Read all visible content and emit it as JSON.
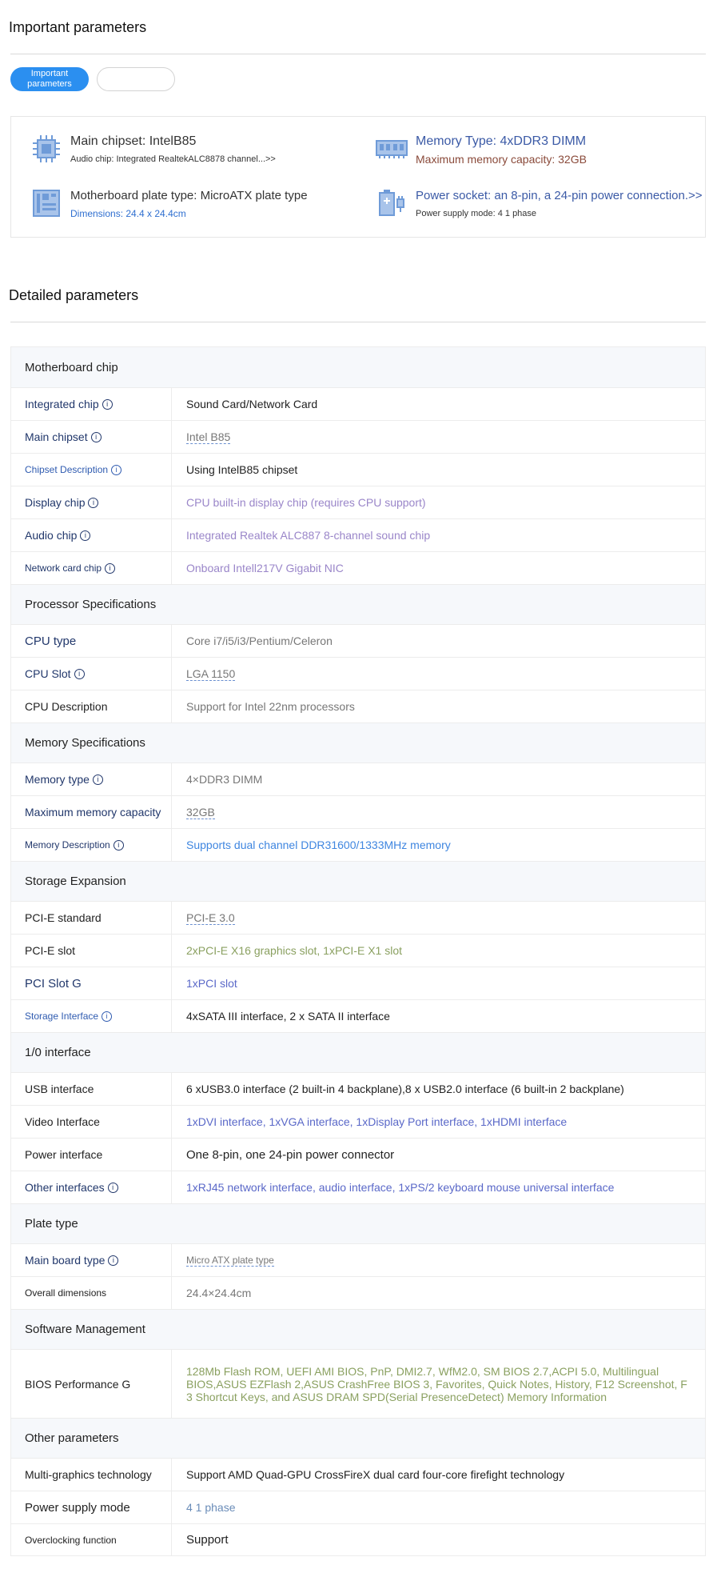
{
  "important": {
    "title": "Important parameters",
    "tabs": [
      "Important\nparameters",
      ""
    ],
    "items": [
      {
        "main": "Main chipset: IntelB85",
        "sub": "Audio chip: Integrated RealtekALC8878 channel...>>",
        "icon": "chip-icon"
      },
      {
        "main": "Memory Type: 4xDDR3 DIMM",
        "sub": "Maximum memory capacity: 32GB",
        "icon": "memory-icon"
      },
      {
        "main": "Motherboard plate type: MicroATX plate type",
        "sub": "Dimensions: 24.4 x 24.4cm",
        "icon": "board-icon"
      },
      {
        "main": "Power socket: an 8-pin, a 24-pin power connection.>>",
        "sub": "Power supply mode: 4 1 phase",
        "icon": "power-icon"
      }
    ]
  },
  "detailed": {
    "title": "Detailed parameters",
    "rows": [
      {
        "type": "group",
        "label": "Motherboard chip",
        "h": 50
      },
      {
        "type": "row",
        "label": "Integrated chip",
        "info": true,
        "value": "Sound Card/Network Card",
        "lc": "lbl-navy",
        "vc": "lbl-dark",
        "h": 41
      },
      {
        "type": "row",
        "label": "Main chipset",
        "info": true,
        "value": "Intel B85",
        "dotted": true,
        "lc": "lbl-navy",
        "vc": "val-gray",
        "h": 41
      },
      {
        "type": "row",
        "label": "Chipset Description",
        "info": true,
        "value": "Using IntelB85 chipset",
        "lc": "lbl-blue",
        "vc": "lbl-dark",
        "h": 41,
        "ls": 12
      },
      {
        "type": "row",
        "label": "Display chip",
        "info": true,
        "value": "CPU built-in display chip (requires CPU support)",
        "lc": "lbl-navy",
        "vc": "val-purple",
        "h": 41
      },
      {
        "type": "row",
        "label": "Audio chip",
        "info": true,
        "value": "Integrated Realtek ALC887 8-channel sound chip",
        "lc": "lbl-navy",
        "vc": "val-purple",
        "h": 41
      },
      {
        "type": "row",
        "label": "Network card chip",
        "info": true,
        "value": "Onboard Intell217V Gigabit NIC",
        "lc": "lbl-navy",
        "vc": "val-purple",
        "h": 41,
        "ls": 12
      },
      {
        "type": "group",
        "label": "Processor Specifications",
        "h": 50
      },
      {
        "type": "row",
        "label": "CPU type",
        "info": false,
        "value": "Core i7/i5/i3/Pentium/Celeron",
        "lc": "lbl-navy",
        "vc": "val-gray",
        "h": 41,
        "ls": 15
      },
      {
        "type": "row",
        "label": "CPU Slot",
        "info": true,
        "value": "LGA 1150",
        "dotted": true,
        "lc": "lbl-navy",
        "vc": "val-gray",
        "h": 41
      },
      {
        "type": "row",
        "label": "CPU Description",
        "info": false,
        "value": "Support for Intel 22nm processors",
        "lc": "lbl-dark",
        "vc": "val-gray",
        "h": 41
      },
      {
        "type": "group",
        "label": "Memory Specifications",
        "h": 50
      },
      {
        "type": "row",
        "label": "Memory type",
        "info": true,
        "value": "4×DDR3 DIMM",
        "lc": "lbl-navy",
        "vc": "val-gray",
        "h": 41
      },
      {
        "type": "row",
        "label": "Maximum memory capacity",
        "info": false,
        "value": "32GB",
        "dotted": true,
        "lc": "lbl-navy",
        "vc": "val-gray",
        "h": 41
      },
      {
        "type": "row",
        "label": "Memory Description",
        "info": true,
        "value": "Supports dual channel DDR31600/1333MHz memory",
        "lc": "lbl-navy",
        "vc": "val-blue",
        "h": 41,
        "ls": 12
      },
      {
        "type": "group",
        "label": "Storage Expansion",
        "h": 50
      },
      {
        "type": "row",
        "label": "PCI-E standard",
        "info": false,
        "value": "PCI-E 3.0",
        "dotted": true,
        "lc": "lbl-dark",
        "vc": "val-gray",
        "h": 41
      },
      {
        "type": "row",
        "label": "PCI-E slot",
        "info": false,
        "value": "2xPCI-E X16 graphics slot, 1xPCI-E X1 slot",
        "lc": "lbl-dark",
        "vc": "val-olive",
        "h": 41
      },
      {
        "type": "row",
        "label": "PCI Slot G",
        "info": false,
        "value": "1xPCI slot",
        "lc": "lbl-navy",
        "vc": "val-indigo",
        "h": 41,
        "ls": 15
      },
      {
        "type": "row",
        "label": "Storage Interface",
        "info": true,
        "value": "4xSATA III interface, 2 x SATA II interface",
        "lc": "lbl-blue",
        "vc": "lbl-dark",
        "h": 41,
        "ls": 12
      },
      {
        "type": "group",
        "label": "1/0 interface",
        "h": 50
      },
      {
        "type": "row",
        "label": "USB interface",
        "info": false,
        "value": "6 xUSB3.0 interface (2 built-in 4 backplane),8 x USB2.0 interface (6 built-in 2 backplane)",
        "lc": "lbl-dark",
        "vc": "lbl-dark",
        "h": 41
      },
      {
        "type": "row",
        "label": "Video Interface",
        "info": false,
        "value": "1xDVI interface, 1xVGA interface, 1xDisplay Port interface, 1xHDMI interface",
        "lc": "lbl-dark",
        "vc": "val-indigo",
        "h": 41
      },
      {
        "type": "row",
        "label": "Power interface",
        "info": false,
        "value": "One 8-pin, one 24-pin power connector",
        "lc": "lbl-dark",
        "vc": "lbl-dark",
        "h": 41,
        "vs": 15
      },
      {
        "type": "row",
        "label": "Other interfaces",
        "info": true,
        "value": "1xRJ45 network interface, audio interface, 1xPS/2 keyboard mouse universal interface",
        "lc": "lbl-navy",
        "vc": "val-indigo",
        "h": 41
      },
      {
        "type": "group",
        "label": "Plate type",
        "h": 50
      },
      {
        "type": "row",
        "label": "Main board type",
        "info": true,
        "value": "Micro ATX plate type",
        "dotted": true,
        "lc": "lbl-navy",
        "vc": "val-gray",
        "h": 41,
        "vs": 12
      },
      {
        "type": "row",
        "label": "Overall dimensions",
        "info": false,
        "value": "24.4×24.4cm",
        "lc": "lbl-dark",
        "vc": "val-gray",
        "h": 41,
        "ls": 12
      },
      {
        "type": "group",
        "label": "Software Management",
        "h": 50
      },
      {
        "type": "row",
        "label": "BIOS Performance G",
        "info": false,
        "value": "128Mb Flash ROM, UEFI AMI BIOS, PnP, DMI2.7, WfM2.0, SM BIOS 2.7,ACPI 5.0, Multilingual BIOS,ASUS EZFlash 2,ASUS CrashFree BIOS 3, Favorites, Quick Notes, History, F12 Screenshot, F 3 Shortcut Keys, and ASUS DRAM SPD(Serial PresenceDetect) Memory Information",
        "lc": "lbl-dark",
        "vc": "val-olive",
        "h": 86
      },
      {
        "type": "group",
        "label": "Other parameters",
        "h": 50
      },
      {
        "type": "row",
        "label": "Multi-graphics technology",
        "info": false,
        "value": "Support AMD Quad-GPU CrossFireX dual card four-core firefight technology",
        "lc": "lbl-dark",
        "vc": "lbl-dark",
        "h": 41
      },
      {
        "type": "row",
        "label": "Power supply mode",
        "info": false,
        "value": "4 1 phase",
        "lc": "lbl-dark",
        "vc": "val-steel",
        "h": 41,
        "ls": 15
      },
      {
        "type": "row",
        "label": "Overclocking function",
        "info": false,
        "value": "Support",
        "lc": "lbl-dark",
        "vc": "lbl-dark",
        "h": 40,
        "ls": 12,
        "vs": 15
      }
    ]
  }
}
